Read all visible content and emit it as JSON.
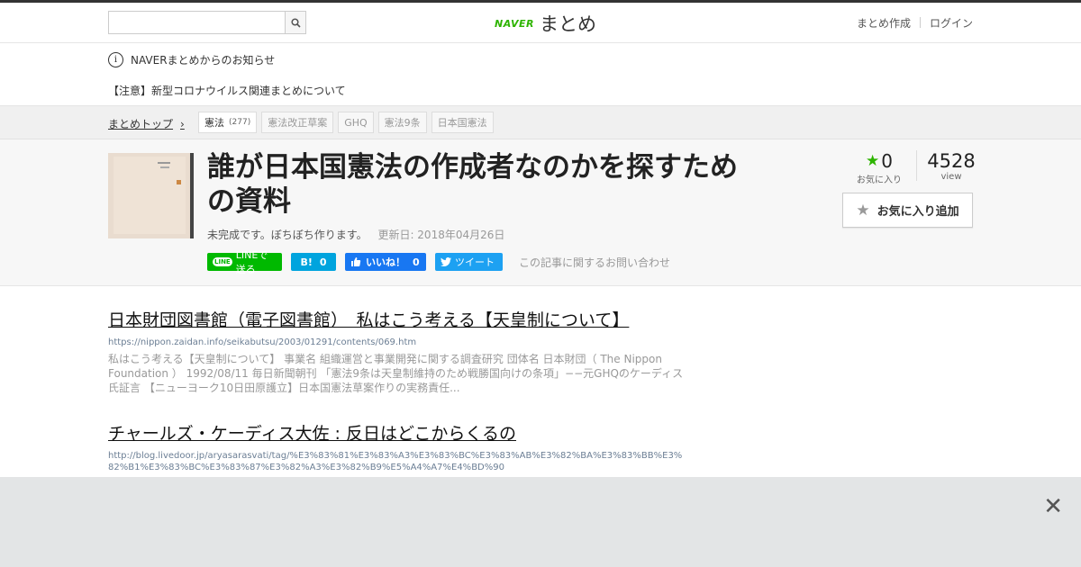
{
  "header": {
    "search_placeholder": "",
    "logo_brand": "NAVER",
    "logo_text": "まとめ",
    "nav": [
      "まとめ作成",
      "ログイン"
    ]
  },
  "notice": {
    "title": "NAVERまとめからのお知らせ",
    "message": "【注意】新型コロナウイルス関連まとめについて"
  },
  "breadcrumb": {
    "home": "まとめトップ",
    "tags": [
      {
        "label": "憲法",
        "count": "(277)"
      },
      {
        "label": "憲法改正草案"
      },
      {
        "label": "GHQ"
      },
      {
        "label": "憲法9条"
      },
      {
        "label": "日本国憲法"
      }
    ]
  },
  "article": {
    "title": "誰が日本国憲法の作成者なのかを探すための資料",
    "description": "未完成です。ぼちぼち作ります。",
    "updated": "更新日: 2018年04月26日",
    "favorites": "0",
    "favorites_label": "お気に入り",
    "views": "4528",
    "views_label": "view",
    "fav_button": "お気に入り追加"
  },
  "share": {
    "line": "LINEで送る",
    "line_badge": "LINE",
    "hatena_label": "B!",
    "hatena_count": "0",
    "fb_label": "いいね！",
    "fb_count": "0",
    "tweet": "ツイート",
    "inquiry": "この記事に関するお問い合わせ"
  },
  "items": [
    {
      "title": "日本財団図書館（電子図書館）　私はこう考える【天皇制について】",
      "url": "https://nippon.zaidan.info/seikabutsu/2003/01291/contents/069.htm",
      "desc": "私はこう考える【天皇制について】 事業名 組織運営と事業開発に関する調査研究 団体名 日本財団（ The Nippon Foundation ） 1992/08/11 毎日新聞朝刊 「憲法9条は天皇制維持のため戦勝国向けの条項」−−元GHQのケーディス氏証言 【ニューヨーク10日田原護立】日本国憲法草案作りの実務責任..."
    },
    {
      "title": "チャールズ・ケーディス大佐 : 反日はどこからくるの",
      "url": "http://blog.livedoor.jp/aryasarasvati/tag/%E3%83%81%E3%83%A3%E3%83%BC%E3%83%AB%E3%82%BA%E3%83%BB%E3%82%B1%E3%83%BC%E3%83%87%E3%82%A3%E3%82%B9%E5%A4%A7%E4%BD%90",
      "desc": ""
    }
  ],
  "colors": {
    "naver_green": "#2db400",
    "line": "#00b900",
    "hatena": "#00a4de",
    "facebook": "#1877f2",
    "twitter": "#1da1f2"
  }
}
